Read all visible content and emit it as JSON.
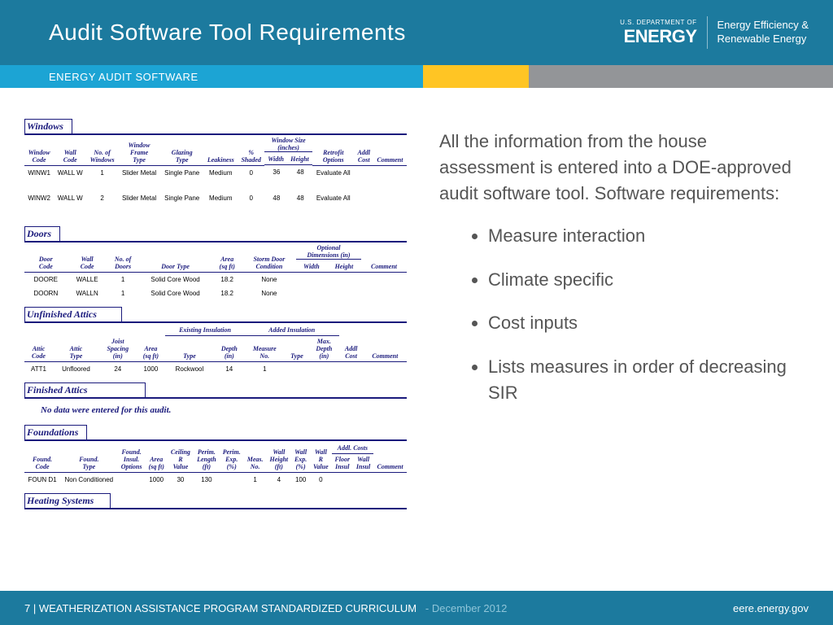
{
  "header": {
    "title": "Audit Software Tool Requirements",
    "logo_sub": "U.S. DEPARTMENT OF",
    "logo_main": "ENERGY",
    "tagline1": "Energy Efficiency &",
    "tagline2": "Renewable Energy"
  },
  "subheader": {
    "label": "ENERGY AUDIT SOFTWARE"
  },
  "body": {
    "intro": "All the information from the house assessment is entered into a DOE-approved audit software tool. Software requirements:",
    "bullets": [
      "Measure interaction",
      "Climate specific",
      "Cost inputs",
      "Lists measures in order of decreasing SIR"
    ]
  },
  "footer": {
    "page": "7",
    "program": "WEATHERIZATION ASSISTANCE PROGRAM STANDARDIZED CURRICULUM",
    "date": "December 2012",
    "url": "eere.energy.gov"
  },
  "report": {
    "windows": {
      "title": "Windows",
      "headers": [
        "Window Code",
        "Wall Code",
        "No. of Windows",
        "Window Frame Type",
        "Glazing Type",
        "Leakiness",
        "% Shaded",
        "Window Size (inches) Width",
        "Height",
        "Retrofit Options",
        "Addl Cost",
        "Comment"
      ],
      "rows": [
        [
          "WINW1",
          "WALL W",
          "1",
          "Slider Metal",
          "Single Pane",
          "Medium",
          "0",
          "36",
          "48",
          "Evaluate All",
          "",
          ""
        ],
        [
          "WINW2",
          "WALL W",
          "2",
          "Slider Metal",
          "Single Pane",
          "Medium",
          "0",
          "48",
          "48",
          "Evaluate All",
          "",
          ""
        ]
      ]
    },
    "doors": {
      "title": "Doors",
      "headers": [
        "Door Code",
        "Wall Code",
        "No. of Doors",
        "Door Type",
        "Area (sq ft)",
        "Storm Door Condition",
        "Optional Dimensions (in) Width",
        "Height",
        "Comment"
      ],
      "rows": [
        [
          "DOORE",
          "WALLE",
          "1",
          "Solid Core Wood",
          "18.2",
          "None",
          "",
          "",
          ""
        ],
        [
          "DOORN",
          "WALLN",
          "1",
          "Solid Core Wood",
          "18.2",
          "None",
          "",
          "",
          ""
        ]
      ]
    },
    "uattics": {
      "title": "Unfinished Attics",
      "group1": "Existing Insulation",
      "group2": "Added Insulation",
      "headers": [
        "Attic Code",
        "Attic Type",
        "Joist Spacing (in)",
        "Area (sq ft)",
        "Type",
        "Depth (in)",
        "Measure No.",
        "Type",
        "Max. Depth (in)",
        "Addl Cost",
        "Comment"
      ],
      "rows": [
        [
          "ATT1",
          "Unfloored",
          "24",
          "1000",
          "Rockwool",
          "14",
          "1",
          "",
          "",
          "",
          ""
        ]
      ]
    },
    "fattics": {
      "title": "Finished Attics",
      "nodata": "No data were entered for this audit."
    },
    "foundations": {
      "title": "Foundations",
      "group": "Addl. Costs",
      "headers": [
        "Found. Code",
        "Found. Type",
        "Found. Insul. Options",
        "Area (sq ft)",
        "Ceiling R Value",
        "Perim. Length (ft)",
        "Perim. Exp. (%)",
        "Meas. No.",
        "Wall Height (ft)",
        "Wall Exp. (%)",
        "Wall R Value",
        "Floor Insul",
        "Wall Insul",
        "Comment"
      ],
      "rows": [
        [
          "FOUN D1",
          "Non Conditioned",
          "",
          "1000",
          "30",
          "130",
          "",
          "1",
          "4",
          "100",
          "0",
          "",
          "",
          ""
        ]
      ]
    },
    "heating": {
      "title": "Heating Systems"
    }
  }
}
